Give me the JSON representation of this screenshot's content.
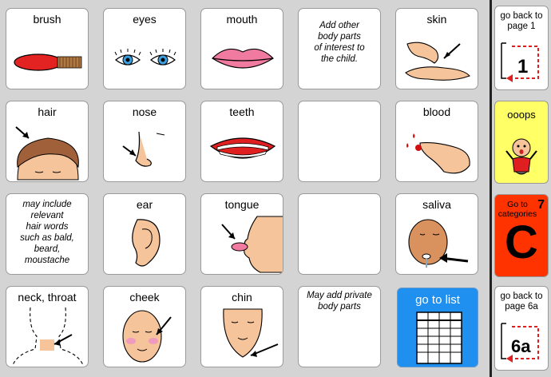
{
  "grid": {
    "brush": "brush",
    "eyes": "eyes",
    "mouth": "mouth",
    "note_add_other": "Add other\nbody parts\nof interest to\nthe child.",
    "skin": "skin",
    "hair": "hair",
    "nose": "nose",
    "teeth": "teeth",
    "blood": "blood",
    "note_hair": "may include\nrelevant\nhair words\nsuch as bald,\nbeard,\nmoustache",
    "ear": "ear",
    "tongue": "tongue",
    "saliva": "saliva",
    "neck_throat": "neck,  throat",
    "cheek": "cheek",
    "chin": "chin",
    "note_private": "May add private\nbody parts",
    "go_to_list": "go to list"
  },
  "sidebar": {
    "page1_label": "go back to\npage 1",
    "page1_num": "1",
    "ooops_label": "ooops",
    "categories_label": "Go to\ncategories",
    "categories_num": "7",
    "categories_letter": "C",
    "page6a_label": "go back to\npage 6a",
    "page6a_num": "6a"
  },
  "colors": {
    "background": "#d4d4d4",
    "go_to_list": "#1f8ff0",
    "ooops": "#ffff66",
    "categories": "#ff3300",
    "arrow_red": "#e02020"
  }
}
